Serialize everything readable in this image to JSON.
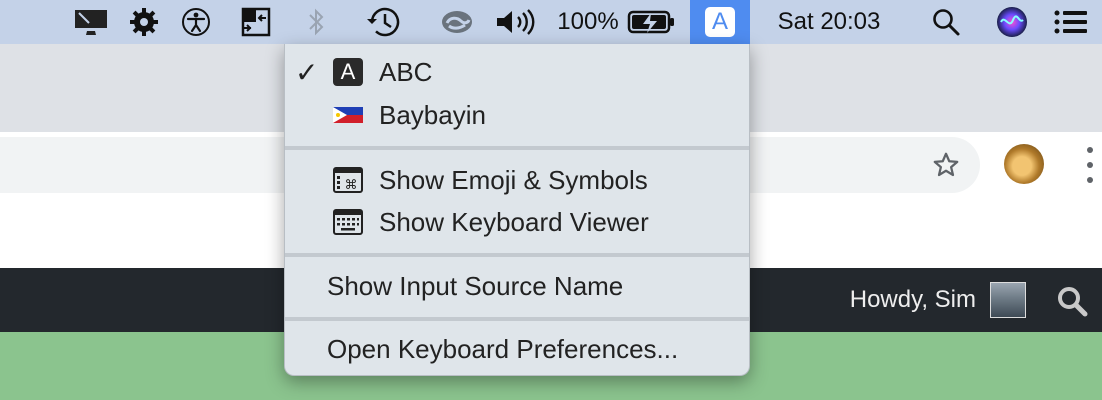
{
  "menubar": {
    "battery": "100%",
    "input_source_badge": "A",
    "clock": "Sat 20:03",
    "icons": [
      "display-icon",
      "gear-icon",
      "accessibility-icon",
      "window-switcher-icon",
      "bluetooth-icon",
      "time-machine-icon",
      "creative-cloud-icon",
      "volume-icon",
      "battery-icon",
      "input-source-icon",
      "spotlight-search-icon",
      "siri-icon",
      "notification-center-icon"
    ]
  },
  "input_menu": {
    "sources": [
      {
        "badge": "A",
        "label": "ABC",
        "selected": true
      },
      {
        "label": "Baybayin",
        "selected": false
      }
    ],
    "emoji_label": "Show Emoji & Symbols",
    "keyboard_viewer_label": "Show Keyboard Viewer",
    "show_name_label": "Show Input Source Name",
    "preferences_label": "Open Keyboard Preferences..."
  },
  "admin_bar": {
    "greeting": "Howdy, Sim"
  },
  "colors": {
    "menubar_bg": "#c4d2e8",
    "active_extra": "#4f8cf0",
    "menu_bg": "#dfe5ea",
    "admin_bar": "#23282d",
    "green_band": "#8bc48e"
  }
}
